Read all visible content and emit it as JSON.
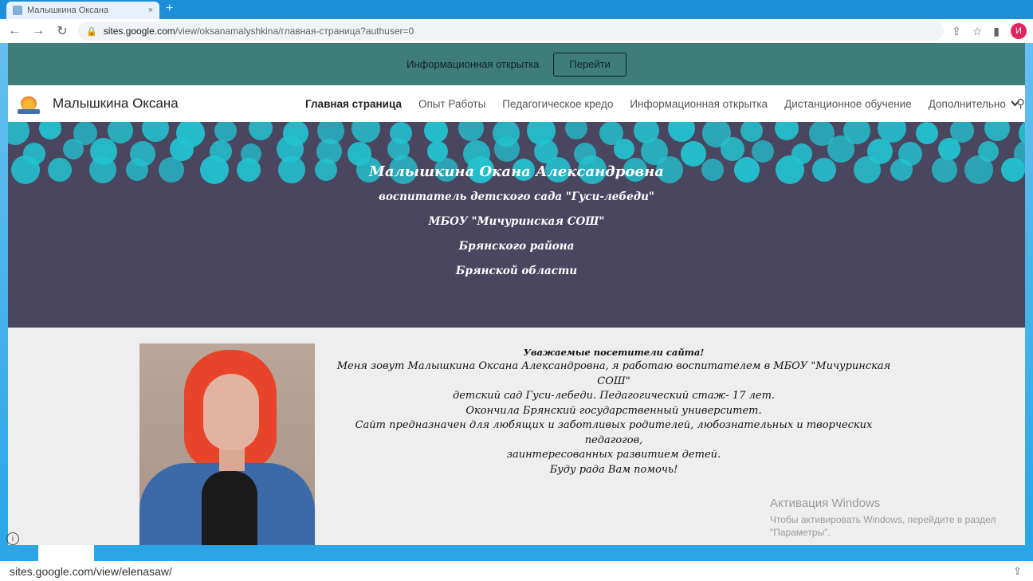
{
  "browser": {
    "tab_title": "Малышкина Оксана",
    "tab_close": "×",
    "new_tab": "+",
    "url_host": "sites.google.com",
    "url_path": "/view/oksanamalyshkina/главная-страница?authuser=0",
    "profile_initial": "И",
    "status_url": "sites.google.com/view/elenasaw/"
  },
  "banner": {
    "text": "Информационная открытка",
    "button": "Перейти"
  },
  "header": {
    "site_title": "Малышкина Оксана",
    "nav": [
      "Главная страница",
      "Опыт Работы",
      "Педагогическое кредо",
      "Информационная открытка",
      "Дистанционное обучение",
      "Дополнительно"
    ]
  },
  "hero": {
    "name": "Малышкина Окана Александровна",
    "line1": "воспитатель детского сада \"Гуси-лебеди\"",
    "line2": "МБОУ \"Мичуринская СОШ\"",
    "line3": "Брянского района",
    "line4": "Брянской области"
  },
  "about": {
    "greeting": "Уважаемые посетители сайта!",
    "p1": "Меня зовут Малышкина Оксана Александровна, я работаю воспитателем в МБОУ \"Мичуринская СОШ\"",
    "p2": "детский сад Гуси-лебеди. Педагогический стаж- 17 лет.",
    "p3": "Окончила Брянский государственный университет.",
    "p4": "Сайт предназначен для любящих и заботливых родителей, любознательных и творческих педагогов,",
    "p5": "заинтересованных развитием детей.",
    "p6": "Буду рада Вам помочь!"
  },
  "watermark": {
    "title": "Активация Windows",
    "line1": "Чтобы активировать Windows, перейдите в раздел",
    "line2": "\"Параметры\"."
  },
  "colors": {
    "banner": "#3e7d7a",
    "hero_bg": "#4b4660",
    "bead": "#22c3d0",
    "frame": "#2aa6e6"
  },
  "icons": [
    "back-icon",
    "forward-icon",
    "reload-icon",
    "lock-icon",
    "share-icon",
    "star-icon",
    "sidebar-icon",
    "search-icon",
    "chevron-down-icon",
    "info-icon"
  ]
}
